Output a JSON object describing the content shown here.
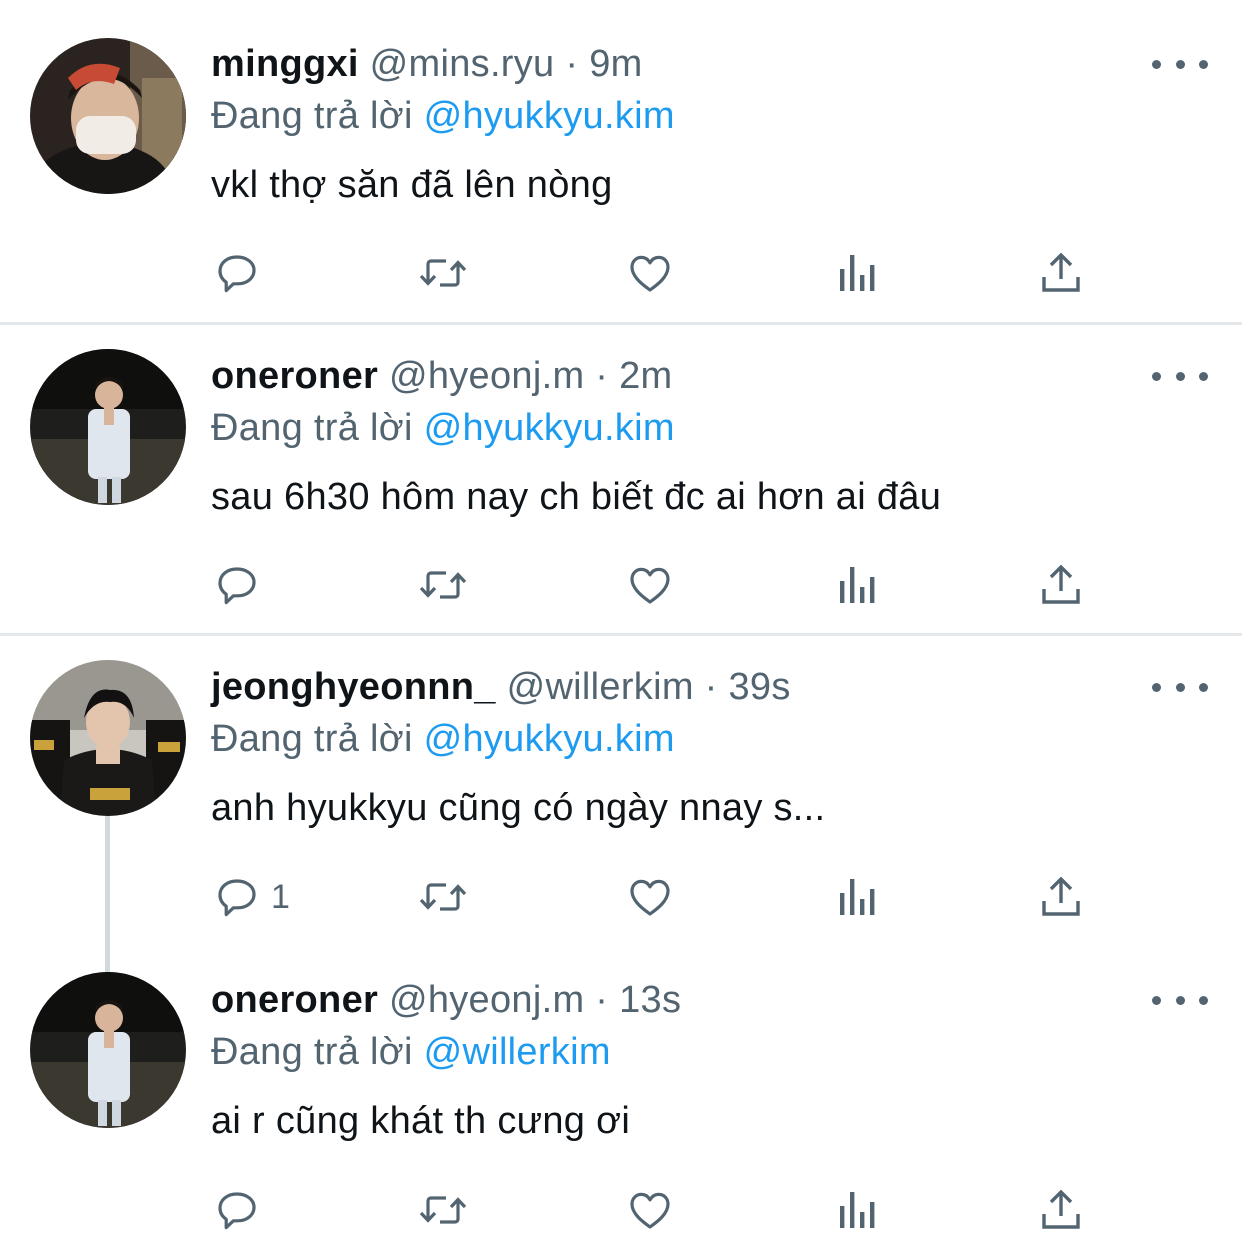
{
  "reply_prefix": "Đang trả lời",
  "tweets": [
    {
      "display_name": "minggxi",
      "handle": "@mins.ryu",
      "separator": "·",
      "time": "9m",
      "reply_to": "@hyukkyu.kim",
      "text": "vkl thợ săn đã lên nòng",
      "reply_count": "",
      "avatar": "avatar-photo-masked-person"
    },
    {
      "display_name": "oneroner",
      "handle": "@hyeonj.m",
      "separator": "·",
      "time": "2m",
      "reply_to": "@hyukkyu.kim",
      "text": "sau 6h30 hôm nay ch biết đc ai hơn ai đâu",
      "reply_count": "",
      "avatar": "avatar-photo-person-night"
    },
    {
      "display_name": "jeonghyeonnn_",
      "handle": "@willerkim",
      "separator": "·",
      "time": "39s",
      "reply_to": "@hyukkyu.kim",
      "text": "anh hyukkyu cũng có ngày nnay s...",
      "reply_count": "1",
      "avatar": "avatar-photo-fearx-jersey"
    },
    {
      "display_name": "oneroner",
      "handle": "@hyeonj.m",
      "separator": "·",
      "time": "13s",
      "reply_to": "@willerkim",
      "text": "ai r cũng khát th cưng ơi",
      "reply_count": "",
      "avatar": "avatar-photo-person-night"
    }
  ],
  "icons": {
    "reply": "reply-icon",
    "retweet": "retweet-icon",
    "like": "like-icon",
    "views": "views-icon",
    "share": "share-icon",
    "more": "more-icon"
  },
  "colors": {
    "text": "#0f1419",
    "secondary": "#536471",
    "link": "#1d9bf0",
    "divider": "#e5e8eb",
    "thread_line": "#cfd9de"
  }
}
